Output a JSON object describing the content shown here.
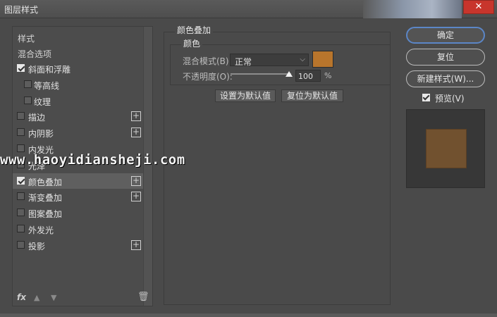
{
  "window": {
    "title": "图层样式",
    "close_glyph": "✕"
  },
  "sidebar": {
    "header": "样式",
    "blend_options": "混合选项",
    "items": [
      {
        "label": "斜面和浮雕",
        "checked": true,
        "indent": false,
        "plus": false
      },
      {
        "label": "等高线",
        "checked": false,
        "indent": true,
        "plus": false
      },
      {
        "label": "纹理",
        "checked": false,
        "indent": true,
        "plus": false
      },
      {
        "label": "描边",
        "checked": false,
        "indent": false,
        "plus": true
      },
      {
        "label": "内阴影",
        "checked": false,
        "indent": false,
        "plus": true
      },
      {
        "label": "内发光",
        "checked": false,
        "indent": false,
        "plus": false
      },
      {
        "label": "光泽",
        "checked": false,
        "indent": false,
        "plus": false
      },
      {
        "label": "颜色叠加",
        "checked": true,
        "indent": false,
        "plus": true,
        "selected": true
      },
      {
        "label": "渐变叠加",
        "checked": false,
        "indent": false,
        "plus": true
      },
      {
        "label": "图案叠加",
        "checked": false,
        "indent": false,
        "plus": false
      },
      {
        "label": "外发光",
        "checked": false,
        "indent": false,
        "plus": false
      },
      {
        "label": "投影",
        "checked": false,
        "indent": false,
        "plus": true
      }
    ],
    "fx_label": "fx",
    "icons": [
      "fx-icon",
      "arrow-up-icon",
      "arrow-down-icon",
      "trash-icon"
    ]
  },
  "panel": {
    "title": "颜色叠加",
    "group_title": "颜色",
    "blend_mode_label": "混合模式(B):",
    "blend_mode_value": "正常",
    "opacity_label": "不透明度(O):",
    "opacity_value": "100",
    "opacity_unit": "%",
    "opacity_fraction": 1.0,
    "overlay_color": "#b8752c",
    "set_default_button": "设置为默认值",
    "reset_default_button": "复位为默认值"
  },
  "right": {
    "ok_button": "确定",
    "reset_button": "复位",
    "new_style_button": "新建样式(W)...",
    "preview_label": "预览(V)",
    "preview_checked": true,
    "preview_color": "#71512f"
  },
  "watermark": "www.haoyidiansheji.com"
}
